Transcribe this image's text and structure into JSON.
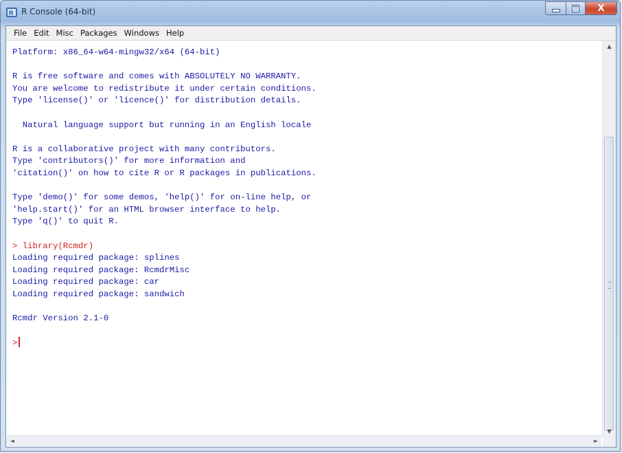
{
  "window": {
    "title": "R Console (64-bit)",
    "close_glyph": "X",
    "scroll_up_glyph": "▲",
    "scroll_down_glyph": "▼",
    "scroll_left_glyph": "◄",
    "scroll_right_glyph": "►"
  },
  "menu": {
    "items": [
      {
        "label": "File"
      },
      {
        "label": "Edit"
      },
      {
        "label": "Misc"
      },
      {
        "label": "Packages"
      },
      {
        "label": "Windows"
      },
      {
        "label": "Help"
      }
    ]
  },
  "console": {
    "lines": [
      {
        "text": "Platform: x86_64-w64-mingw32/x64 (64-bit)",
        "kind": "output"
      },
      {
        "text": "",
        "kind": "output"
      },
      {
        "text": "R is free software and comes with ABSOLUTELY NO WARRANTY.",
        "kind": "output"
      },
      {
        "text": "You are welcome to redistribute it under certain conditions.",
        "kind": "output"
      },
      {
        "text": "Type 'license()' or 'licence()' for distribution details.",
        "kind": "output"
      },
      {
        "text": "",
        "kind": "output"
      },
      {
        "text": "  Natural language support but running in an English locale",
        "kind": "output"
      },
      {
        "text": "",
        "kind": "output"
      },
      {
        "text": "R is a collaborative project with many contributors.",
        "kind": "output"
      },
      {
        "text": "Type 'contributors()' for more information and",
        "kind": "output"
      },
      {
        "text": "'citation()' on how to cite R or R packages in publications.",
        "kind": "output"
      },
      {
        "text": "",
        "kind": "output"
      },
      {
        "text": "Type 'demo()' for some demos, 'help()' for on-line help, or",
        "kind": "output"
      },
      {
        "text": "'help.start()' for an HTML browser interface to help.",
        "kind": "output"
      },
      {
        "text": "Type 'q()' to quit R.",
        "kind": "output"
      },
      {
        "text": "",
        "kind": "output"
      },
      {
        "text": "> library(Rcmdr)",
        "kind": "input"
      },
      {
        "text": "Loading required package: splines",
        "kind": "output"
      },
      {
        "text": "Loading required package: RcmdrMisc",
        "kind": "output"
      },
      {
        "text": "Loading required package: car",
        "kind": "output"
      },
      {
        "text": "Loading required package: sandwich",
        "kind": "output"
      },
      {
        "text": "",
        "kind": "output"
      },
      {
        "text": "Rcmdr Version 2.1-0",
        "kind": "output"
      },
      {
        "text": "",
        "kind": "output"
      }
    ],
    "prompt": ">",
    "output_color": "#1a1aa6",
    "input_color": "#d21f1f"
  }
}
